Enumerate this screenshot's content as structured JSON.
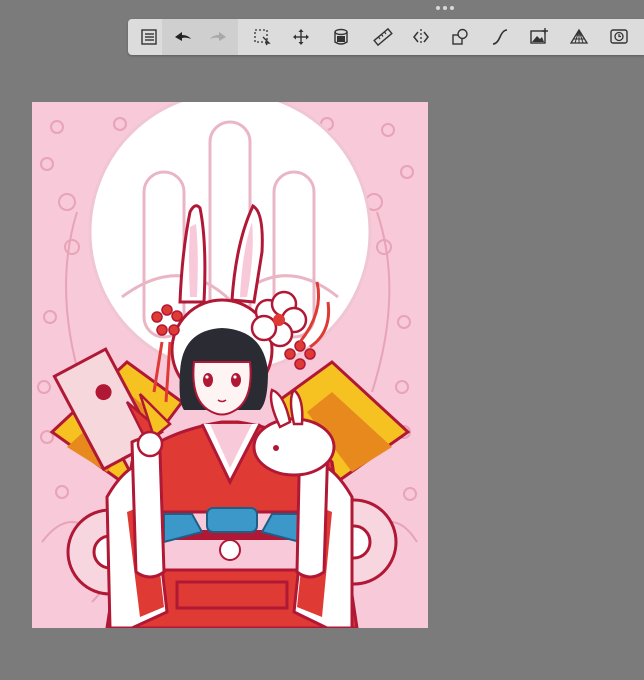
{
  "app": {
    "name": "drawing-canvas-editor"
  },
  "toolbar": {
    "tools": [
      {
        "id": "menu",
        "icon": "list-menu-icon"
      },
      {
        "id": "undo",
        "icon": "undo-arrow-icon"
      },
      {
        "id": "redo",
        "icon": "redo-arrow-icon",
        "state": "disabled"
      },
      {
        "id": "selection",
        "icon": "selection-tool-icon"
      },
      {
        "id": "transform",
        "icon": "move-arrows-icon"
      },
      {
        "id": "fill",
        "icon": "fill-bucket-icon"
      },
      {
        "id": "ruler",
        "icon": "ruler-icon"
      },
      {
        "id": "symmetry",
        "icon": "symmetry-icon"
      },
      {
        "id": "shapes",
        "icon": "shapes-icon"
      },
      {
        "id": "curves",
        "icon": "curve-tool-icon"
      },
      {
        "id": "image",
        "icon": "image-import-icon"
      },
      {
        "id": "perspective",
        "icon": "perspective-grid-icon"
      },
      {
        "id": "time-lapse",
        "icon": "timelapse-icon"
      }
    ]
  },
  "canvas": {
    "artwork": "illustration-girl-in-red-kimono-with-bunny-hood",
    "colors": {
      "background": "#f8c9d9",
      "outline": "#b01835",
      "kimono": "#e03a34",
      "sash": "#3c98c8",
      "gold": "#f5c221",
      "moon": "#ffffff",
      "sketch": "#e7a3b8"
    }
  }
}
